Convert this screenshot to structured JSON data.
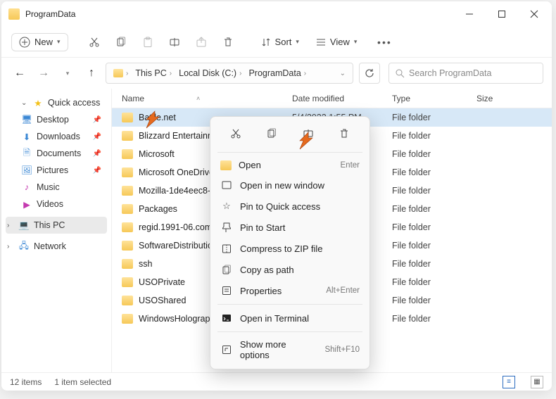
{
  "window_title": "ProgramData",
  "toolbar": {
    "new_label": "New",
    "sort_label": "Sort",
    "view_label": "View"
  },
  "breadcrumb": [
    "This PC",
    "Local Disk (C:)",
    "ProgramData"
  ],
  "search_placeholder": "Search ProgramData",
  "sidebar": {
    "quick_access": "Quick access",
    "items": [
      {
        "label": "Desktop"
      },
      {
        "label": "Downloads"
      },
      {
        "label": "Documents"
      },
      {
        "label": "Pictures"
      },
      {
        "label": "Music"
      },
      {
        "label": "Videos"
      }
    ],
    "this_pc": "This PC",
    "network": "Network"
  },
  "columns": {
    "name": "Name",
    "date": "Date modified",
    "type": "Type",
    "size": "Size"
  },
  "rows": [
    {
      "name": "Battle.net",
      "date": "5/4/2022 1:55 PM",
      "type": "File folder",
      "selected": true
    },
    {
      "name": "Blizzard Entertainment",
      "date": "",
      "type": "File folder"
    },
    {
      "name": "Microsoft",
      "date": "",
      "type": "File folder"
    },
    {
      "name": "Microsoft OneDrive",
      "date": "",
      "type": "File folder"
    },
    {
      "name": "Mozilla-1de4eec8-1241-",
      "date": "",
      "type": "File folder"
    },
    {
      "name": "Packages",
      "date": "",
      "type": "File folder"
    },
    {
      "name": "regid.1991-06.com.microsoft",
      "date": "",
      "type": "File folder"
    },
    {
      "name": "SoftwareDistribution",
      "date": "",
      "type": "File folder"
    },
    {
      "name": "ssh",
      "date": "",
      "type": "File folder"
    },
    {
      "name": "USOPrivate",
      "date": "",
      "type": "File folder"
    },
    {
      "name": "USOShared",
      "date": "",
      "type": "File folder"
    },
    {
      "name": "WindowsHolographicDevices",
      "date": "",
      "type": "File folder"
    }
  ],
  "status": {
    "count": "12 items",
    "selected": "1 item selected"
  },
  "context_menu": {
    "open": {
      "label": "Open",
      "shortcut": "Enter"
    },
    "open_new": {
      "label": "Open in new window"
    },
    "pin_qa": {
      "label": "Pin to Quick access"
    },
    "pin_start": {
      "label": "Pin to Start"
    },
    "zip": {
      "label": "Compress to ZIP file"
    },
    "copy_path": {
      "label": "Copy as path"
    },
    "properties": {
      "label": "Properties",
      "shortcut": "Alt+Enter"
    },
    "terminal": {
      "label": "Open in Terminal"
    },
    "more": {
      "label": "Show more options",
      "shortcut": "Shift+F10"
    }
  },
  "annotation": {
    "arrow_color": "#e56a1e"
  }
}
